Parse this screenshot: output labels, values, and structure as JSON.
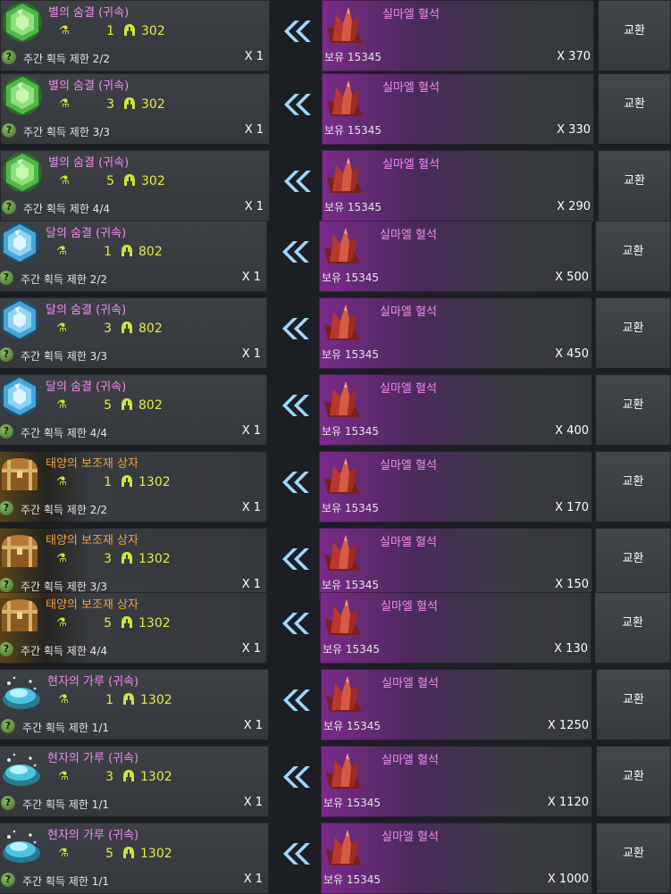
{
  "colors": {
    "item_name_purple": "#f08cf0",
    "item_name_gold": "#f3a23a",
    "level_yellow": "#e7ec45",
    "arrow_blue": "#9fd8ff",
    "reward_purple": "#7a2a8a"
  },
  "rows": [
    {
      "icon": "star-gem-icon",
      "name": "별의 숨결 (귀속)",
      "name_style": "purple",
      "level": "1",
      "price": "302",
      "limit": "주간 획득 제한 2/2",
      "multiplier": "X 1",
      "reward_icon": "red-crystal-icon",
      "reward_name": "실마엘 혈석",
      "owned": "보유 15345",
      "reward_qty": "X 370",
      "button": "교환"
    },
    {
      "icon": "star-gem-icon",
      "name": "별의 숨결 (귀속)",
      "name_style": "purple",
      "level": "3",
      "price": "302",
      "limit": "주간 획득 제한 3/3",
      "multiplier": "X 1",
      "reward_icon": "red-crystal-icon",
      "reward_name": "실마엘 혈석",
      "owned": "보유 15345",
      "reward_qty": "X 330",
      "button": "교환"
    },
    {
      "icon": "star-gem-icon",
      "name": "별의 숨결 (귀속)",
      "name_style": "purple",
      "level": "5",
      "price": "302",
      "limit": "주간 획득 제한 4/4",
      "multiplier": "X 1",
      "reward_icon": "red-crystal-icon",
      "reward_name": "실마엘 혈석",
      "owned": "보유 15345",
      "reward_qty": "X 290",
      "button": "교환"
    },
    {
      "icon": "moon-gem-icon",
      "name": "달의 숨결 (귀속)",
      "name_style": "purple",
      "level": "1",
      "price": "802",
      "limit": "주간 획득 제한 2/2",
      "multiplier": "X 1",
      "reward_icon": "red-crystal-icon",
      "reward_name": "실마엘 혈석",
      "owned": "보유 15345",
      "reward_qty": "X 500",
      "button": "교환"
    },
    {
      "icon": "moon-gem-icon",
      "name": "달의 숨결 (귀속)",
      "name_style": "purple",
      "level": "3",
      "price": "802",
      "limit": "주간 획득 제한 3/3",
      "multiplier": "X 1",
      "reward_icon": "red-crystal-icon",
      "reward_name": "실마엘 혈석",
      "owned": "보유 15345",
      "reward_qty": "X 450",
      "button": "교환"
    },
    {
      "icon": "moon-gem-icon",
      "name": "달의 숨결 (귀속)",
      "name_style": "purple",
      "level": "5",
      "price": "802",
      "limit": "주간 획득 제한 4/4",
      "multiplier": "X 1",
      "reward_icon": "red-crystal-icon",
      "reward_name": "실마엘 혈석",
      "owned": "보유 15345",
      "reward_qty": "X 400",
      "button": "교환"
    },
    {
      "icon": "treasure-chest-icon",
      "name": "태양의 보조재 상자",
      "name_style": "gold",
      "level": "1",
      "price": "1302",
      "limit": "주간 획득 제한 2/2",
      "multiplier": "X 1",
      "reward_icon": "red-crystal-icon",
      "reward_name": "실마엘 혈석",
      "owned": "보유 15345",
      "reward_qty": "X 170",
      "button": "교환"
    },
    {
      "icon": "treasure-chest-icon",
      "name": "태양의 보조재 상자",
      "name_style": "gold",
      "level": "3",
      "price": "1302",
      "limit": "주간 획득 제한 3/3",
      "multiplier": "X 1",
      "reward_icon": "red-crystal-icon",
      "reward_name": "실마엘 혈석",
      "owned": "보유 15345",
      "reward_qty": "X 150",
      "button": "교환"
    },
    {
      "icon": "treasure-chest-icon",
      "name": "태양의 보조재 상자",
      "name_style": "gold",
      "level": "5",
      "price": "1302",
      "limit": "주간 획득 제한 4/4",
      "multiplier": "X 1",
      "reward_icon": "red-crystal-icon",
      "reward_name": "실마엘 혈석",
      "owned": "보유 15345",
      "reward_qty": "X 130",
      "button": "교환"
    },
    {
      "icon": "sage-powder-icon",
      "name": "현자의 가루 (귀속)",
      "name_style": "purple",
      "level": "1",
      "price": "1302",
      "limit": "주간 획득 제한 1/1",
      "multiplier": "X 1",
      "reward_icon": "red-crystal-icon",
      "reward_name": "실마엘 혈석",
      "owned": "보유 15345",
      "reward_qty": "X 1250",
      "button": "교환"
    },
    {
      "icon": "sage-powder-icon",
      "name": "현자의 가루 (귀속)",
      "name_style": "purple",
      "level": "3",
      "price": "1302",
      "limit": "주간 획득 제한 1/1",
      "multiplier": "X 1",
      "reward_icon": "red-crystal-icon",
      "reward_name": "실마엘 혈석",
      "owned": "보유 15345",
      "reward_qty": "X 1120",
      "button": "교환"
    },
    {
      "icon": "sage-powder-icon",
      "name": "현자의 가루 (귀속)",
      "name_style": "purple",
      "level": "5",
      "price": "1302",
      "limit": "주간 획득 제한 1/1",
      "multiplier": "X 1",
      "reward_icon": "red-crystal-icon",
      "reward_name": "실마엘 혈석",
      "owned": "보유 15345",
      "reward_qty": "X 1000",
      "button": "교환"
    }
  ]
}
